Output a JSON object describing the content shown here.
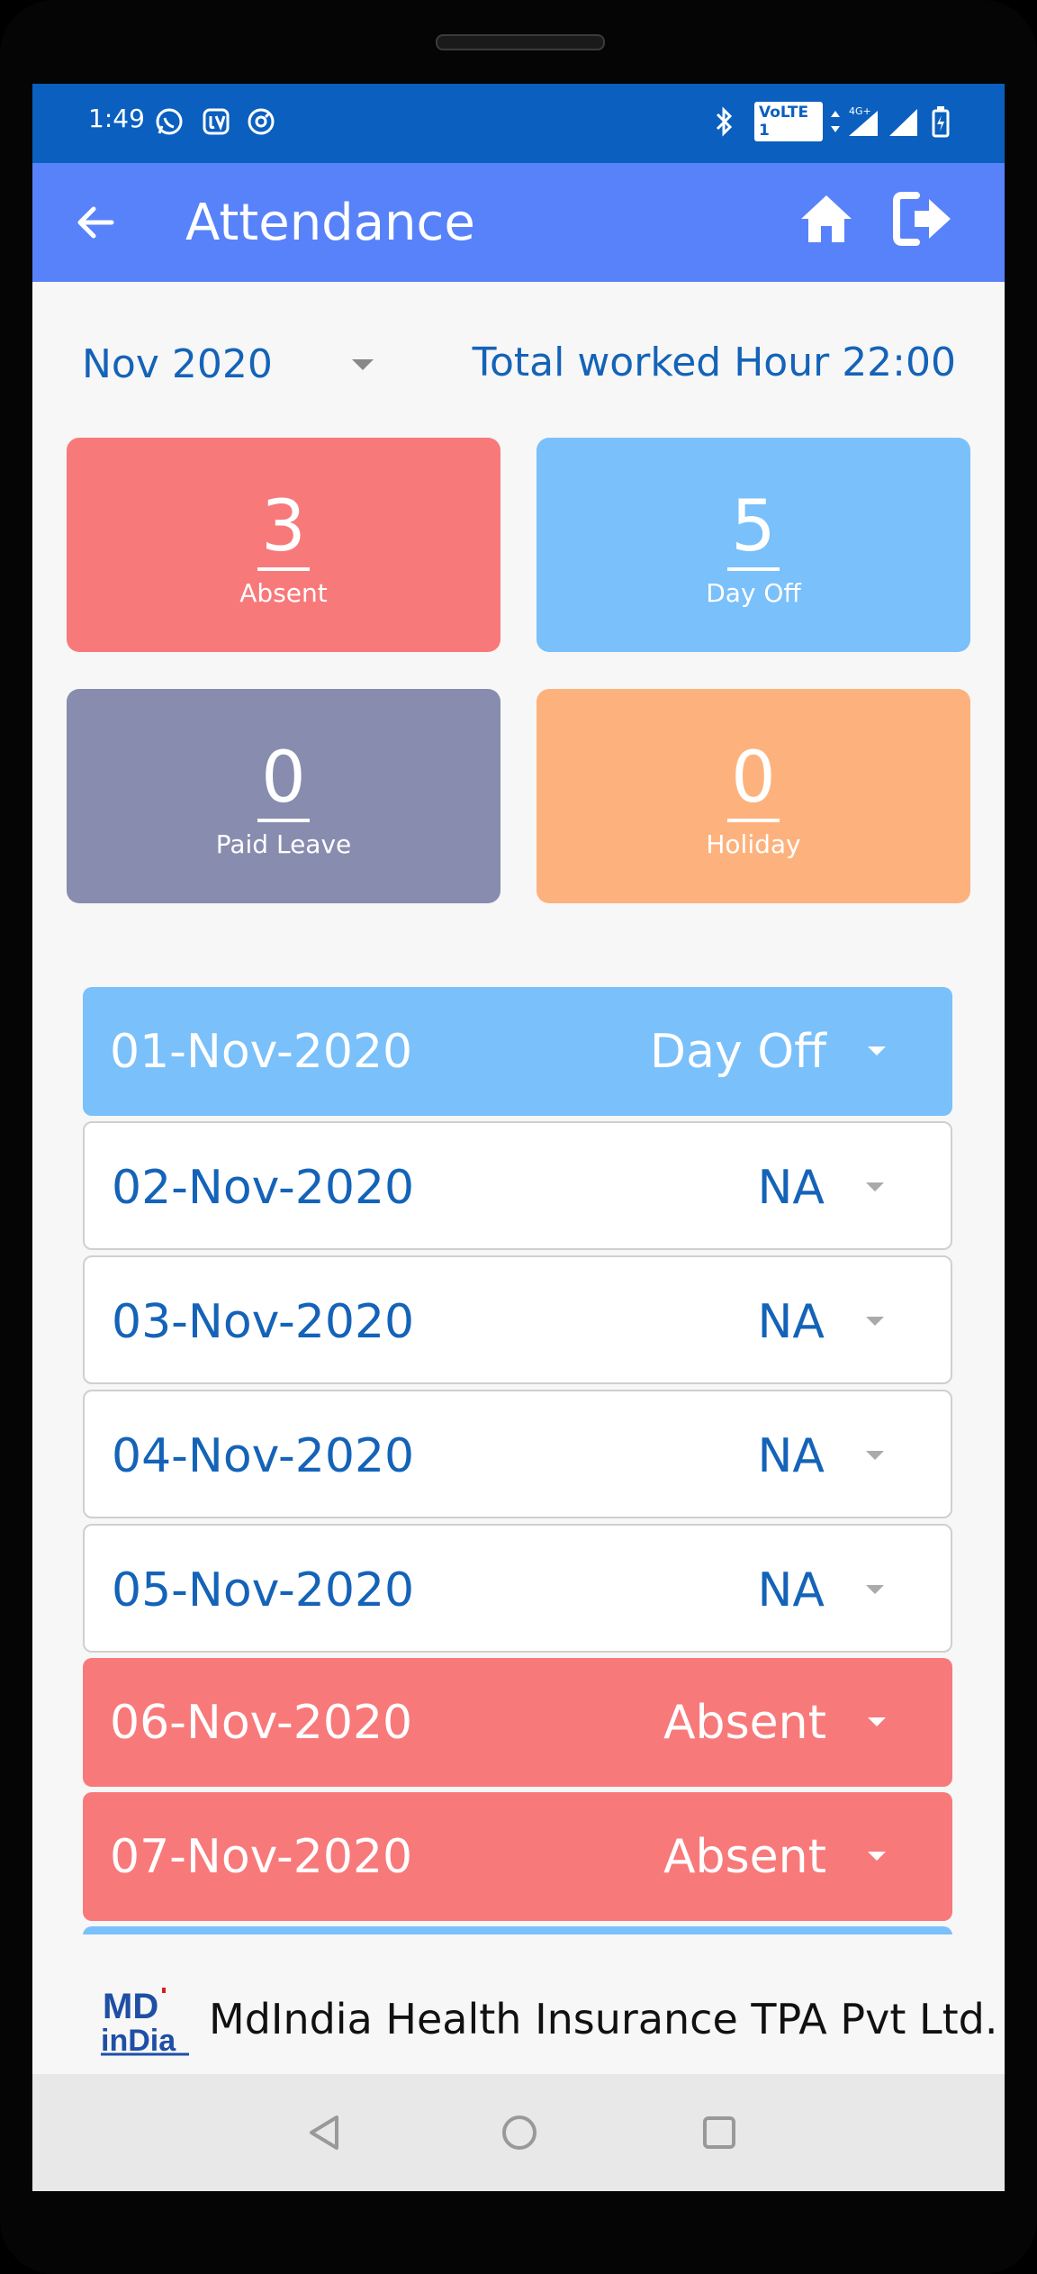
{
  "status_bar": {
    "time": "1:49",
    "network_label": "VoLTE 1",
    "network_type": "4G+"
  },
  "app_bar": {
    "title": "Attendance",
    "back_icon": "arrow-left-icon",
    "home_icon": "home-icon",
    "logout_icon": "logout-icon"
  },
  "filter": {
    "month": "Nov 2020",
    "total_worked": "Total worked Hour 22:00"
  },
  "summary": [
    {
      "value": "3",
      "label": "Absent",
      "color": "#f8797a"
    },
    {
      "value": "5",
      "label": "Day Off",
      "color": "#7ac0fa"
    },
    {
      "value": "0",
      "label": "Paid Leave",
      "color": "#888cae"
    },
    {
      "value": "0",
      "label": "Holiday",
      "color": "#fdb27d"
    }
  ],
  "attendance": [
    {
      "date": "01-Nov-2020",
      "status": "Day Off"
    },
    {
      "date": "02-Nov-2020",
      "status": "NA"
    },
    {
      "date": "03-Nov-2020",
      "status": "NA"
    },
    {
      "date": "04-Nov-2020",
      "status": "NA"
    },
    {
      "date": "05-Nov-2020",
      "status": "NA"
    },
    {
      "date": "06-Nov-2020",
      "status": "Absent"
    },
    {
      "date": "07-Nov-2020",
      "status": "Absent"
    }
  ],
  "colors": {
    "status_bar": "#0a5fbf",
    "app_bar": "#5882f9",
    "text_blue": "#1463b8",
    "day_off": "#7ac0fa",
    "absent": "#f8797a",
    "na": "#ffffff"
  },
  "footer": {
    "logo_text_top": "MD",
    "logo_text_bottom": "inDia",
    "company": "MdIndia Health Insurance TPA Pvt Ltd."
  }
}
